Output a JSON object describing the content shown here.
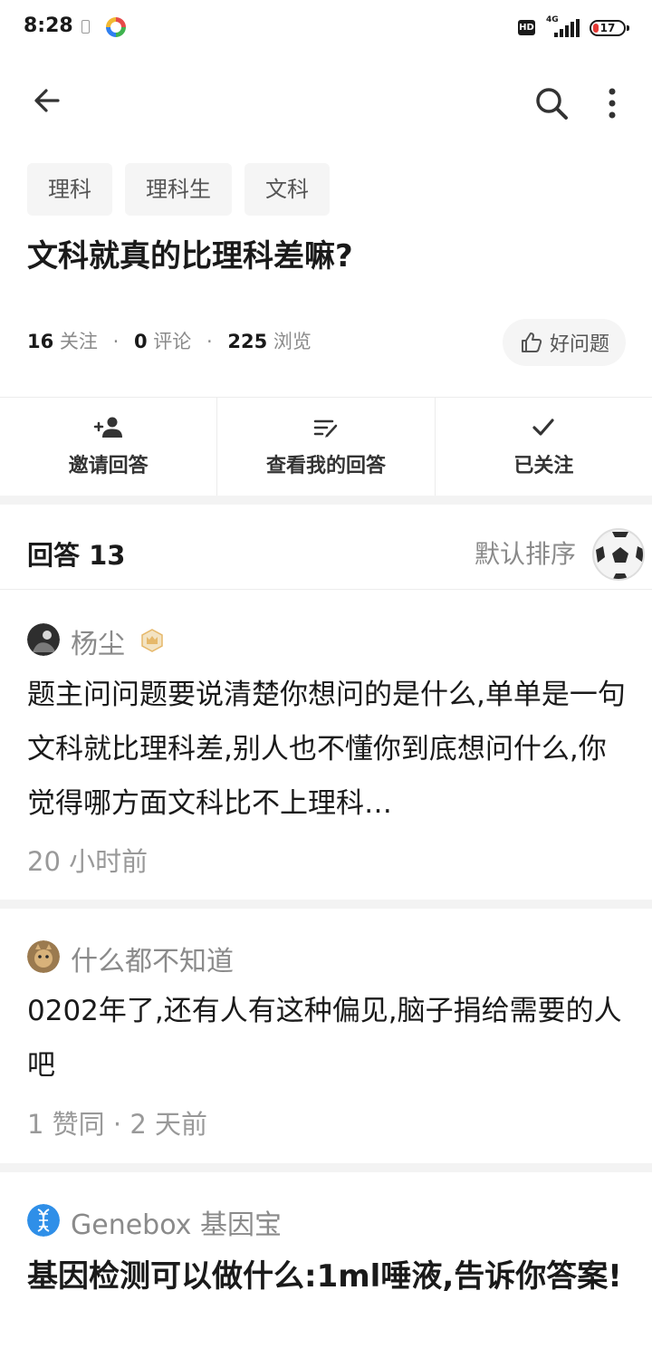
{
  "status_bar": {
    "time": "8:28",
    "hd": "HD",
    "network": "4G",
    "battery": "17"
  },
  "toolbar": {
    "back": "back-arrow-icon",
    "search": "search-icon",
    "more": "more-vertical-icon"
  },
  "tags": [
    "理科",
    "理科生",
    "文科"
  ],
  "question": {
    "title": "文科就真的比理科差嘛?",
    "followers_count": "16",
    "followers_label": "关注",
    "comments_count": "0",
    "comments_label": "评论",
    "views_count": "225",
    "views_label": "浏览",
    "separator": "·",
    "good_question_label": "好问题"
  },
  "actions": {
    "invite": "邀请回答",
    "view_mine": "查看我的回答",
    "followed": "已关注"
  },
  "answers_header": {
    "title": "回答 13",
    "sort": "默认排序"
  },
  "answers": [
    {
      "author": "杨尘",
      "content": "题主问问题要说清楚你想问的是什么,单单是一句文科就比理科差,别人也不懂你到底想问什么,你觉得哪方面文科比不上理科…",
      "meta": "20 小时前"
    },
    {
      "author": "什么都不知道",
      "content": "0202年了,还有人有这种偏见,脑子捐给需要的人吧",
      "meta": "1 赞同 · 2 天前"
    }
  ],
  "ad": {
    "author": "Genebox 基因宝",
    "title": "基因检测可以做什么:1ml唾液,告诉你答案!"
  },
  "colors": {
    "text_primary": "#1a1a1a",
    "text_secondary": "#8a8a8a",
    "tag_bg": "#f5f5f5",
    "battery_low": "#e53935",
    "badge_gold": "#e6b86a"
  }
}
